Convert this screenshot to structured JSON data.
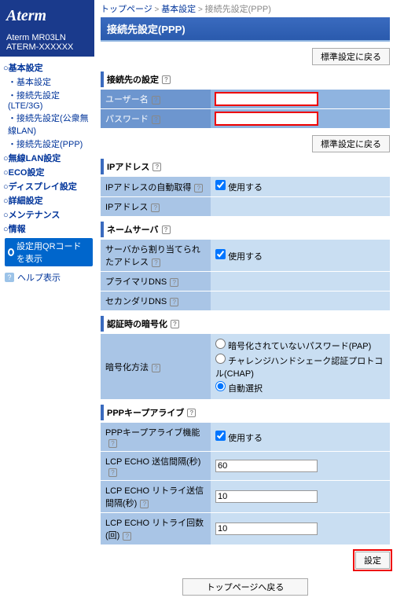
{
  "logo": "Aterm",
  "model1": "Aterm MR03LN",
  "model2": "ATERM-XXXXXX",
  "nav": {
    "basic": "基本設定",
    "basic_sub1": "基本設定",
    "basic_sub2": "接続先設定(LTE/3G)",
    "basic_sub3": "接続先設定(公衆無線LAN)",
    "basic_sub4": "接続先設定(PPP)",
    "wlan": "無線LAN設定",
    "eco": "ECO設定",
    "disp": "ディスプレイ設定",
    "detail": "詳細設定",
    "maint": "メンテナンス",
    "info": "情報",
    "qr": "設定用QRコードを表示",
    "help": "ヘルプ表示"
  },
  "crumb": {
    "top": "トップページ",
    "basic": "基本設定",
    "here": "接続先設定(PPP)"
  },
  "title": "接続先設定(PPP)",
  "btn_std": "標準設定に戻る",
  "btn_set": "設定",
  "btn_top": "トップページへ戻る",
  "sec": {
    "conn": "接続先の設定",
    "ip": "IPアドレス",
    "ns": "ネームサーバ",
    "auth": "認証時の暗号化",
    "ka": "PPPキープアライブ"
  },
  "row": {
    "user": "ユーザー名",
    "pass": "パスワード",
    "autoip": "IPアドレスの自動取得",
    "ipaddr": "IPアドレス",
    "srv": "サーバから割り当てられたアドレス",
    "pdns": "プライマリDNS",
    "sdns": "セカンダリDNS",
    "enc": "暗号化方法",
    "kaen": "PPPキープアライブ機能",
    "lcp1": "LCP ECHO 送信間隔(秒)",
    "lcp2": "LCP ECHO リトライ送信間隔(秒)",
    "lcp3": "LCP ECHO リトライ回数(回)"
  },
  "val": {
    "use": "使用する",
    "pap": "暗号化されていないパスワード(PAP)",
    "chap": "チャレンジハンドシェーク認証プロトコル(CHAP)",
    "auto": "自動選択",
    "lcp1": "60",
    "lcp2": "10",
    "lcp3": "10"
  }
}
